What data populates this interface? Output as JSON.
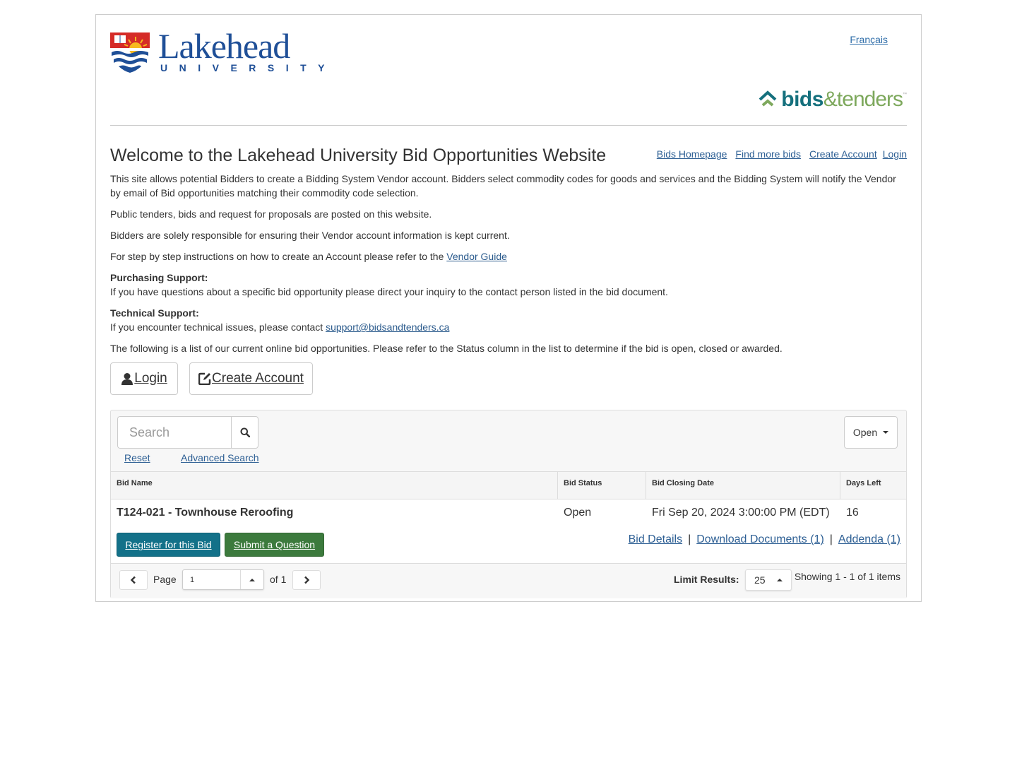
{
  "header": {
    "university_name": "Lakehead",
    "university_sub": "UNIVERSITY",
    "language_link": "Français",
    "brand_bids": "bids",
    "brand_tenders": "&tenders",
    "brand_tm": "™"
  },
  "topnav": [
    {
      "label": "Bids Homepage"
    },
    {
      "label": "Find more bids"
    },
    {
      "label": "Create Account"
    },
    {
      "label": "Login"
    }
  ],
  "title": "Welcome to the Lakehead University Bid Opportunities Website",
  "intro": {
    "p1": "This site allows potential Bidders to create a Bidding System Vendor account.  Bidders select commodity codes for goods and services and the Bidding System will notify the Vendor by email of Bid opportunities matching their commodity code selection.",
    "p2": "Public tenders, bids and request for proposals are posted on this website.",
    "p3": "Bidders are solely responsible for ensuring their Vendor account information is kept current.",
    "p4_text": "For step by step instructions on how to create an Account please refer to the ",
    "p4_link": "Vendor Guide",
    "purchasing_heading": "Purchasing Support:",
    "purchasing_text": "If you have questions about a specific bid opportunity please direct your inquiry to the contact person listed in the bid document.",
    "technical_heading": "Technical Support:",
    "technical_text": "If you encounter technical issues, please contact ",
    "technical_email": "support@bidsandtenders.ca",
    "list_text": "The following is a list of our current online bid opportunities. Please refer to the Status column in the list to determine if the bid is open, closed or awarded."
  },
  "actions": {
    "login_label": "Login",
    "create_account_label": "Create Account"
  },
  "search": {
    "placeholder": "Search",
    "value": "",
    "reset_label": "Reset",
    "advanced_label": "Advanced Search",
    "status_filter": "Open"
  },
  "table": {
    "columns": [
      "Bid Name",
      "Bid Status",
      "Bid Closing Date",
      "Days Left"
    ],
    "rows": [
      {
        "name": "T124-021 - Townhouse Reroofing",
        "status": "Open",
        "closing_date": "Fri Sep 20, 2024 3:00:00 PM (EDT)",
        "days_left": "16",
        "register_label": "Register for this Bid",
        "question_label": "Submit a Question",
        "details_label": "Bid Details",
        "documents_label": "Download Documents (1)",
        "addenda_label": "Addenda (1)",
        "separator": "|"
      }
    ]
  },
  "pager": {
    "page_label": "Page",
    "page_value": "1",
    "of_label": "of 1",
    "limit_label": "Limit Results:",
    "limit_value": "25",
    "showing": "Showing 1 - 1 of 1 items"
  },
  "colors": {
    "link": "#2d5f94",
    "register_button": "#137189",
    "question_button": "#3c7a3d",
    "university_blue": "#1f4f97",
    "bids_teal": "#15707d",
    "tenders_green": "#7da85c"
  }
}
